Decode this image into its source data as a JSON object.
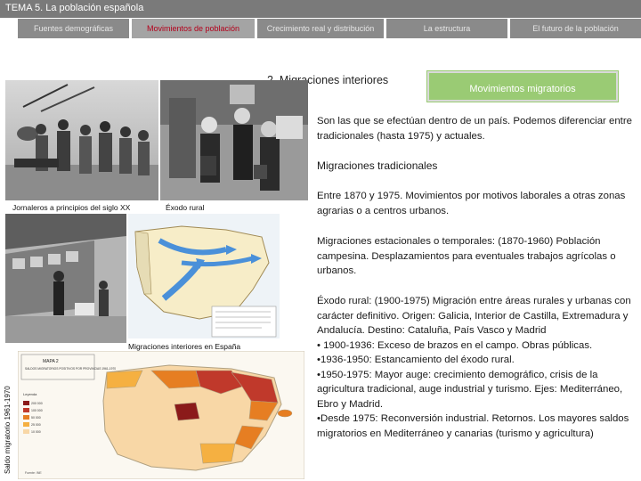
{
  "header": {
    "title": "TEMA 5. La población española"
  },
  "nav": {
    "tabs": [
      {
        "label": "Fuentes demográficas"
      },
      {
        "label": "Movimientos de población"
      },
      {
        "label": "Crecimiento real y distribución"
      },
      {
        "label": "La estructura"
      },
      {
        "label": "El futuro de la población"
      }
    ]
  },
  "section": {
    "title": "2. Migraciones interiores",
    "highlight": "Movimientos migratorios"
  },
  "captions": {
    "jornaleros": "Jornaleros a principios del siglo XX",
    "exodo": "Éxodo rural",
    "mapa": "Migraciones interiores en España",
    "saldo": "Saldo migratorio 1961-1970"
  },
  "map_text": {
    "mapa2_title": "MAPA 2",
    "mapa2_subtitle": "SALDOS MIGRATORIOS POSITIVOS POR PROVINCIAS 1961-1970",
    "leyenda": "Leyenda",
    "legend": [
      "200 000",
      "100 000",
      "50 000",
      "25 000",
      "10 000"
    ],
    "fuente": "Fuente: INE"
  },
  "content": {
    "intro": "Son las que se efectúan dentro de un país. Podemos diferenciar entre tradicionales (hasta 1975) y actuales.",
    "heading": "Migraciones tradicionales",
    "periodo": "Entre 1870 y 1975. Movimientos por motivos laborales a otras zonas agrarias o a centros urbanos.",
    "estacionales": "Migraciones estacionales o temporales: (1870-1960) Población campesina. Desplazamientos para eventuales trabajos agrícolas o urbanos.",
    "exodo_intro": "Éxodo rural: (1900-1975) Migración entre áreas rurales y urbanas con carácter definitivo. Origen: Galicia, Interior de Castilla, Extremadura y Andalucía. Destino: Cataluña, País Vasco y Madrid",
    "bullets": [
      "• 1900-1936: Exceso de brazos en el campo. Obras públicas.",
      "•1936-1950: Estancamiento del éxodo rural.",
      "•1950-1975: Mayor auge: crecimiento demográfico, crisis de la agricultura tradicional, auge industrial y turismo. Ejes: Mediterráneo, Ebro y Madrid.",
      "•Desde 1975: Reconversión industrial. Retornos. Los mayores saldos migratorios en Mediterráneo y canarias (turismo y agricultura)"
    ]
  },
  "colors": {
    "topbar": "#7a7a7a",
    "nav_tab": "#8a8a8a",
    "nav_tab_active_text": "#b3001b",
    "highlight_fill": "#9acb74",
    "map_province_dark": "#c0392b",
    "map_province_mid": "#e67e22",
    "map_province_light": "#f8d7a6"
  }
}
